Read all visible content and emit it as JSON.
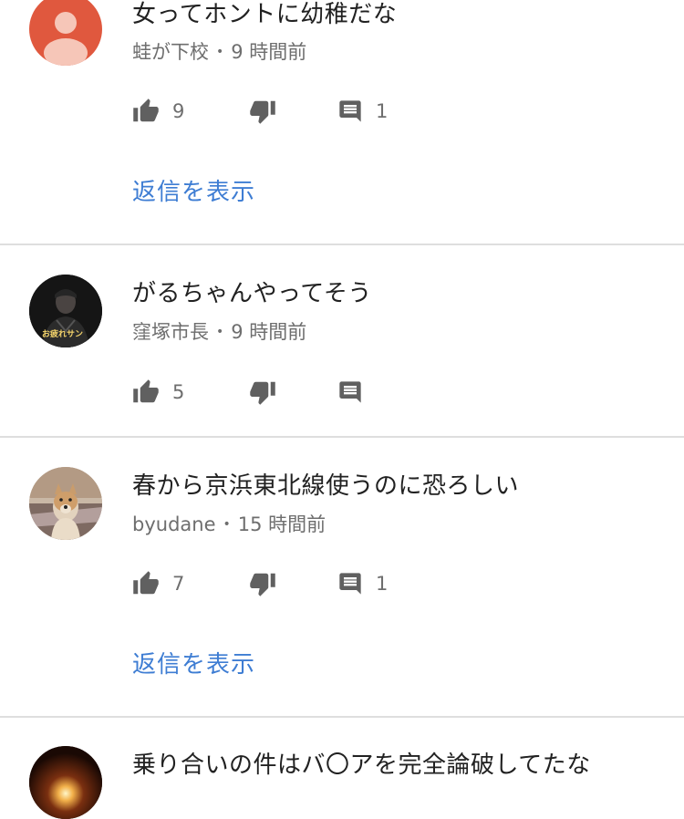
{
  "comments": [
    {
      "text": "女ってホントに幼稚だな",
      "author": "蛙が下校",
      "time": "9 時間前",
      "likes": "9",
      "reply_count": "1",
      "show_replies": "返信を表示"
    },
    {
      "text": "がるちゃんやってそう",
      "author": "窪塚市長",
      "time": "9 時間前",
      "likes": "5",
      "avatar_caption": "お疲れサン"
    },
    {
      "text": "春から京浜東北線使うのに恐ろしい",
      "author": "byudane",
      "time": "15 時間前",
      "likes": "7",
      "reply_count": "1",
      "show_replies": "返信を表示"
    },
    {
      "text": "乗り合いの件はバ〇アを完全論破してたな"
    }
  ],
  "colors": {
    "link": "#3e7dd3",
    "meta": "#6e6e6e",
    "divider": "#dedede",
    "default_avatar": "#e0583e"
  },
  "icons": [
    "thumb-up-icon",
    "thumb-down-icon",
    "reply-comment-icon"
  ]
}
